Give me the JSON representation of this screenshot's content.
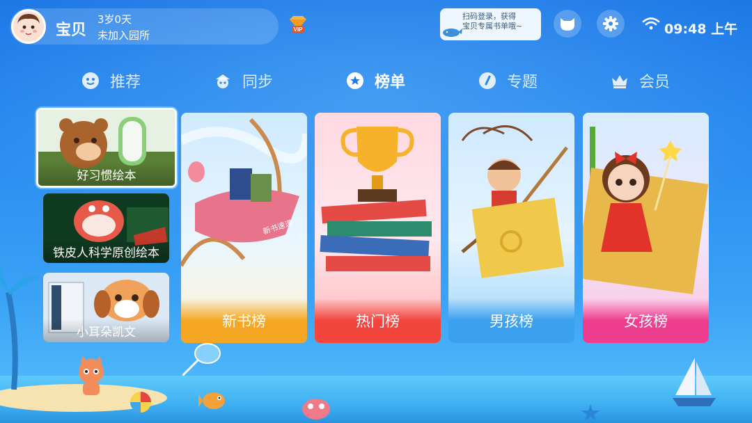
{
  "user": {
    "name": "宝贝",
    "age": "3岁0天",
    "school": "未加入园所"
  },
  "vip_badge_text": "VIP",
  "scan_tip": {
    "line1": "扫码登录，获得",
    "line2": "宝贝专属书单哦~"
  },
  "status": {
    "time": "09:48 上午"
  },
  "tabs": [
    {
      "label": "推荐",
      "icon": "recommend-icon",
      "active": false
    },
    {
      "label": "同步",
      "icon": "sync-icon",
      "active": false
    },
    {
      "label": "榜单",
      "icon": "ranking-icon",
      "active": true
    },
    {
      "label": "专题",
      "icon": "topic-icon",
      "active": false
    },
    {
      "label": "会员",
      "icon": "crown-icon",
      "active": false
    }
  ],
  "side_cards": [
    {
      "label": "好习惯绘本",
      "selected": true
    },
    {
      "label": "铁皮人科学原创绘本",
      "selected": false
    },
    {
      "label": "小耳朵凯文",
      "selected": false
    }
  ],
  "rank_cards": [
    {
      "label": "新书榜",
      "art_text": "新书速递"
    },
    {
      "label": "热门榜"
    },
    {
      "label": "男孩榜"
    },
    {
      "label": "女孩榜"
    }
  ],
  "colors": {
    "background_top": "#1e78e6",
    "new_books_label": "#f5a623",
    "hot_label": "#f2453d",
    "boys_label": "#3aa0ef",
    "girls_label": "#ee3d8f"
  }
}
